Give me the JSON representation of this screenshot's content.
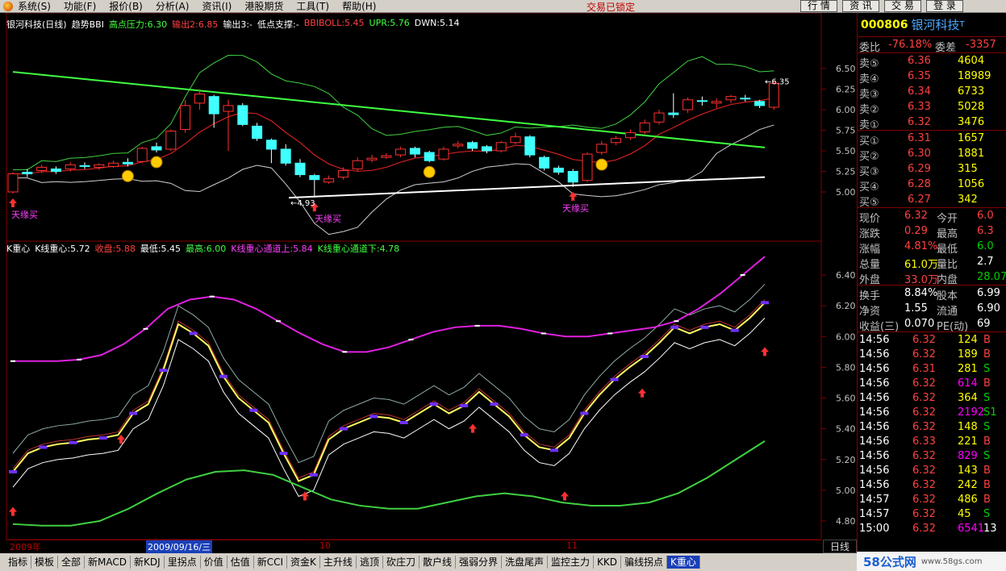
{
  "menu": {
    "items": [
      "系统(S)",
      "功能(F)",
      "报价(B)",
      "分析(A)",
      "资讯(I)",
      "港股期货",
      "工具(T)",
      "帮助(H)"
    ],
    "status": "交易已锁定",
    "right_buttons": [
      "行 情",
      "资 讯",
      "交 易",
      "登 录"
    ]
  },
  "upper_legend": [
    {
      "text": "银河科技(日线)",
      "color": "#ffffff"
    },
    {
      "text": "趋势BBI",
      "color": "#ffffff"
    },
    {
      "text": "高点压力:6.30",
      "color": "#40ff40"
    },
    {
      "text": "输出2:6.85",
      "color": "#ff4040"
    },
    {
      "text": "输出3:-",
      "color": "#ffffff"
    },
    {
      "text": "低点支撑:-",
      "color": "#ffffff"
    },
    {
      "text": "BBIBOLL:5.45",
      "color": "#ff4040"
    },
    {
      "text": "UPR:5.76",
      "color": "#40ff40"
    },
    {
      "text": "DWN:5.14",
      "color": "#ffffff"
    }
  ],
  "lower_legend": [
    {
      "text": "K重心",
      "color": "#ffffff"
    },
    {
      "text": "K线重心:5.72",
      "color": "#ffffff"
    },
    {
      "text": "收盘:5.88",
      "color": "#ff4040"
    },
    {
      "text": "最低:5.45",
      "color": "#ffffff"
    },
    {
      "text": "最高:6.00",
      "color": "#40ff40"
    },
    {
      "text": "K线重心通道上:5.84",
      "color": "#ff40ff"
    },
    {
      "text": "K线重心通道下:4.78",
      "color": "#40ff40"
    }
  ],
  "upper_axis": [
    "6.50",
    "6.25",
    "6.00",
    "5.75",
    "5.50",
    "5.25",
    "5.00"
  ],
  "lower_axis": [
    "6.40",
    "6.20",
    "6.00",
    "5.80",
    "5.60",
    "5.40",
    "5.20",
    "5.00",
    "4.80"
  ],
  "annotations": {
    "buy_label": "天缘买",
    "low_label": "4.93",
    "high_label": "6.35"
  },
  "datebar": {
    "year": "2009年",
    "cursor_date": "2009/09/16/三",
    "month_10": "10",
    "month_11": "11",
    "period": "日线"
  },
  "tabs": [
    "指标",
    "模板",
    "全部",
    "新MACD",
    "新KDJ",
    "里拐点",
    "价值",
    "估值",
    "新CCI",
    "资金K",
    "主升线",
    "逃顶",
    "砍庄刀",
    "散户线",
    "强弱分界",
    "洗盘尾声",
    "监控主力",
    "KKD",
    "骗线拐点",
    "K重心"
  ],
  "active_tab": "K重心",
  "panel": {
    "code": "000806",
    "name": "银河科技",
    "name_mark": "T",
    "weibi_label": "委比",
    "weibi": "-76.18%",
    "weicha_label": "委差",
    "weicha": "-3357",
    "asks": [
      {
        "label": "卖⑤",
        "price": "6.36",
        "vol": "4604"
      },
      {
        "label": "卖④",
        "price": "6.35",
        "vol": "18989"
      },
      {
        "label": "卖③",
        "price": "6.34",
        "vol": "6733"
      },
      {
        "label": "卖②",
        "price": "6.33",
        "vol": "5028"
      },
      {
        "label": "卖①",
        "price": "6.32",
        "vol": "3476"
      }
    ],
    "bids": [
      {
        "label": "买①",
        "price": "6.31",
        "vol": "1657"
      },
      {
        "label": "买②",
        "price": "6.30",
        "vol": "1881"
      },
      {
        "label": "买③",
        "price": "6.29",
        "vol": "315"
      },
      {
        "label": "买④",
        "price": "6.28",
        "vol": "1056"
      },
      {
        "label": "买⑤",
        "price": "6.27",
        "vol": "342"
      }
    ],
    "stats": [
      {
        "l1": "现价",
        "v1": "6.32",
        "c1": "red",
        "l2": "今开",
        "v2": "6.0",
        "c2": "red"
      },
      {
        "l1": "涨跌",
        "v1": "0.29",
        "c1": "red",
        "l2": "最高",
        "v2": "6.3",
        "c2": "red"
      },
      {
        "l1": "涨幅",
        "v1": "4.81%",
        "c1": "red",
        "l2": "最低",
        "v2": "6.0",
        "c2": "grn"
      },
      {
        "l1": "总量",
        "v1": "61.0万",
        "c1": "yel",
        "l2": "量比",
        "v2": "2.7",
        "c2": "wht"
      },
      {
        "l1": "外盘",
        "v1": "33.0万",
        "c1": "red",
        "l2": "内盘",
        "v2": "28.07",
        "c2": "grn"
      }
    ],
    "stats2": [
      {
        "l1": "换手",
        "v1": "8.84%",
        "c1": "wht",
        "l2": "股本",
        "v2": "6.99",
        "c2": "wht"
      },
      {
        "l1": "净资",
        "v1": "1.55",
        "c1": "wht",
        "l2": "流通",
        "v2": "6.90",
        "c2": "wht"
      },
      {
        "l1": "收益(三)",
        "v1": "0.070",
        "c1": "wht",
        "l2": "PE(动)",
        "v2": "69",
        "c2": "wht"
      }
    ],
    "ticks": [
      {
        "t": "14:56",
        "p": "6.32",
        "pc": "red",
        "v": "124",
        "vc": "yel",
        "s": "B",
        "sc": "red"
      },
      {
        "t": "14:56",
        "p": "6.32",
        "pc": "red",
        "v": "189",
        "vc": "yel",
        "s": "B",
        "sc": "red"
      },
      {
        "t": "14:56",
        "p": "6.31",
        "pc": "red",
        "v": "281",
        "vc": "yel",
        "s": "S",
        "sc": "grn"
      },
      {
        "t": "14:56",
        "p": "6.32",
        "pc": "red",
        "v": "614",
        "vc": "pur",
        "s": "B",
        "sc": "red"
      },
      {
        "t": "14:56",
        "p": "6.32",
        "pc": "red",
        "v": "364",
        "vc": "yel",
        "s": "S",
        "sc": "grn"
      },
      {
        "t": "14:56",
        "p": "6.32",
        "pc": "red",
        "v": "2192",
        "vc": "pur",
        "s": "S1",
        "sc": "grn"
      },
      {
        "t": "14:56",
        "p": "6.32",
        "pc": "red",
        "v": "148",
        "vc": "yel",
        "s": "S",
        "sc": "grn"
      },
      {
        "t": "14:56",
        "p": "6.33",
        "pc": "red",
        "v": "221",
        "vc": "yel",
        "s": "B",
        "sc": "red"
      },
      {
        "t": "14:56",
        "p": "6.32",
        "pc": "red",
        "v": "829",
        "vc": "pur",
        "s": "S",
        "sc": "grn"
      },
      {
        "t": "14:56",
        "p": "6.32",
        "pc": "red",
        "v": "143",
        "vc": "yel",
        "s": "B",
        "sc": "red"
      },
      {
        "t": "14:56",
        "p": "6.32",
        "pc": "red",
        "v": "242",
        "vc": "yel",
        "s": "B",
        "sc": "red"
      },
      {
        "t": "14:57",
        "p": "6.32",
        "pc": "red",
        "v": "486",
        "vc": "yel",
        "s": "B",
        "sc": "red"
      },
      {
        "t": "14:57",
        "p": "6.32",
        "pc": "red",
        "v": "45",
        "vc": "yel",
        "s": "S",
        "sc": "grn"
      },
      {
        "t": "15:00",
        "p": "6.32",
        "pc": "red",
        "v": "6541",
        "vc": "pur",
        "s": "13",
        "sc": "wht"
      }
    ]
  },
  "watermark": {
    "main": "58公式网",
    "sub": "www.58gs.com"
  },
  "chart_data": {
    "type": "candlestick",
    "candles": [
      {
        "o": 5.0,
        "c": 5.22,
        "h": 5.24,
        "l": 4.98
      },
      {
        "o": 5.24,
        "c": 5.22,
        "h": 5.28,
        "l": 5.18
      },
      {
        "o": 5.26,
        "c": 5.3,
        "h": 5.33,
        "l": 5.23
      },
      {
        "o": 5.28,
        "c": 5.25,
        "h": 5.31,
        "l": 5.22
      },
      {
        "o": 5.28,
        "c": 5.33,
        "h": 5.36,
        "l": 5.25
      },
      {
        "o": 5.32,
        "c": 5.31,
        "h": 5.36,
        "l": 5.28
      },
      {
        "o": 5.3,
        "c": 5.33,
        "h": 5.35,
        "l": 5.27
      },
      {
        "o": 5.31,
        "c": 5.35,
        "h": 5.38,
        "l": 5.29
      },
      {
        "o": 5.36,
        "c": 5.34,
        "h": 5.41,
        "l": 5.31
      },
      {
        "o": 5.37,
        "c": 5.53,
        "h": 5.55,
        "l": 5.35
      },
      {
        "o": 5.55,
        "c": 5.51,
        "h": 5.6,
        "l": 5.48
      },
      {
        "o": 5.52,
        "c": 5.74,
        "h": 5.76,
        "l": 5.5
      },
      {
        "o": 5.76,
        "c": 6.05,
        "h": 6.12,
        "l": 5.72
      },
      {
        "o": 6.08,
        "c": 6.19,
        "h": 6.25,
        "l": 6.0
      },
      {
        "o": 6.16,
        "c": 5.95,
        "h": 6.18,
        "l": 5.78
      },
      {
        "o": 5.98,
        "c": 6.05,
        "h": 6.12,
        "l": 5.5
      },
      {
        "o": 6.05,
        "c": 5.82,
        "h": 6.08,
        "l": 5.8
      },
      {
        "o": 5.8,
        "c": 5.65,
        "h": 5.84,
        "l": 5.62
      },
      {
        "o": 5.63,
        "c": 5.52,
        "h": 5.65,
        "l": 5.35
      },
      {
        "o": 5.52,
        "c": 5.35,
        "h": 5.58,
        "l": 5.32
      },
      {
        "o": 5.35,
        "c": 5.21,
        "h": 5.4,
        "l": 5.18
      },
      {
        "o": 5.2,
        "c": 5.15,
        "h": 5.22,
        "l": 4.93
      },
      {
        "o": 5.12,
        "c": 5.16,
        "h": 5.2,
        "l": 5.1
      },
      {
        "o": 5.18,
        "c": 5.26,
        "h": 5.3,
        "l": 5.15
      },
      {
        "o": 5.28,
        "c": 5.38,
        "h": 5.42,
        "l": 5.25
      },
      {
        "o": 5.39,
        "c": 5.41,
        "h": 5.45,
        "l": 5.36
      },
      {
        "o": 5.42,
        "c": 5.44,
        "h": 5.47,
        "l": 5.4
      },
      {
        "o": 5.45,
        "c": 5.52,
        "h": 5.55,
        "l": 5.42
      },
      {
        "o": 5.53,
        "c": 5.46,
        "h": 5.55,
        "l": 5.42
      },
      {
        "o": 5.48,
        "c": 5.38,
        "h": 5.5,
        "l": 5.36
      },
      {
        "o": 5.4,
        "c": 5.52,
        "h": 5.55,
        "l": 5.38
      },
      {
        "o": 5.56,
        "c": 5.58,
        "h": 5.62,
        "l": 5.53
      },
      {
        "o": 5.6,
        "c": 5.53,
        "h": 5.62,
        "l": 5.5
      },
      {
        "o": 5.55,
        "c": 5.5,
        "h": 5.57,
        "l": 5.47
      },
      {
        "o": 5.5,
        "c": 5.6,
        "h": 5.62,
        "l": 5.48
      },
      {
        "o": 5.6,
        "c": 5.67,
        "h": 5.72,
        "l": 5.58
      },
      {
        "o": 5.67,
        "c": 5.45,
        "h": 5.69,
        "l": 5.42
      },
      {
        "o": 5.42,
        "c": 5.29,
        "h": 5.44,
        "l": 5.26
      },
      {
        "o": 5.29,
        "c": 5.24,
        "h": 5.32,
        "l": 5.21
      },
      {
        "o": 5.25,
        "c": 5.12,
        "h": 5.28,
        "l": 5.06
      },
      {
        "o": 5.14,
        "c": 5.46,
        "h": 5.48,
        "l": 5.12
      },
      {
        "o": 5.48,
        "c": 5.58,
        "h": 5.62,
        "l": 5.45
      },
      {
        "o": 5.6,
        "c": 5.65,
        "h": 5.68,
        "l": 5.57
      },
      {
        "o": 5.66,
        "c": 5.72,
        "h": 5.76,
        "l": 5.63
      },
      {
        "o": 5.73,
        "c": 5.84,
        "h": 5.88,
        "l": 5.7
      },
      {
        "o": 5.85,
        "c": 5.96,
        "h": 6.0,
        "l": 5.82
      },
      {
        "o": 5.96,
        "c": 5.94,
        "h": 6.2,
        "l": 5.9
      },
      {
        "o": 6.0,
        "c": 6.12,
        "h": 6.15,
        "l": 5.96
      },
      {
        "o": 6.11,
        "c": 6.1,
        "h": 6.16,
        "l": 6.05
      },
      {
        "o": 6.08,
        "c": 6.1,
        "h": 6.14,
        "l": 6.02
      },
      {
        "o": 6.12,
        "c": 6.16,
        "h": 6.18,
        "l": 6.08
      },
      {
        "o": 6.14,
        "c": 6.13,
        "h": 6.18,
        "l": 6.1
      },
      {
        "o": 6.1,
        "c": 6.05,
        "h": 6.12,
        "l": 6.02
      },
      {
        "o": 6.03,
        "c": 6.32,
        "h": 6.35,
        "l": 6.0
      }
    ],
    "lower_kline_center": [
      5.12,
      5.24,
      5.28,
      5.3,
      5.31,
      5.33,
      5.34,
      5.36,
      5.5,
      5.56,
      5.78,
      6.08,
      6.02,
      5.94,
      5.74,
      5.6,
      5.52,
      5.44,
      5.24,
      5.06,
      5.1,
      5.33,
      5.4,
      5.44,
      5.48,
      5.47,
      5.44,
      5.5,
      5.56,
      5.5,
      5.55,
      5.64,
      5.56,
      5.48,
      5.36,
      5.28,
      5.26,
      5.34,
      5.5,
      5.62,
      5.72,
      5.8,
      5.87,
      5.96,
      6.06,
      6.02,
      6.06,
      6.08,
      6.04,
      6.12,
      6.22
    ],
    "lower_channel_up": [
      5.84,
      5.84,
      5.84,
      5.85,
      5.88,
      5.95,
      6.05,
      6.18,
      6.24,
      6.26,
      6.24,
      6.18,
      6.1,
      6.02,
      5.95,
      5.9,
      5.9,
      5.93,
      5.98,
      6.03,
      6.06,
      6.07,
      6.07,
      6.05,
      6.02,
      6.0,
      6.0,
      6.02,
      6.04,
      6.06,
      6.1,
      6.18,
      6.28,
      6.4,
      6.52
    ],
    "lower_channel_down": [
      4.78,
      4.77,
      4.77,
      4.8,
      4.88,
      4.98,
      5.07,
      5.12,
      5.13,
      5.1,
      5.02,
      4.94,
      4.9,
      4.88,
      4.88,
      4.92,
      4.96,
      4.98,
      4.96,
      4.92,
      4.9,
      4.9,
      4.92,
      4.98,
      5.08,
      5.2,
      5.32
    ]
  }
}
